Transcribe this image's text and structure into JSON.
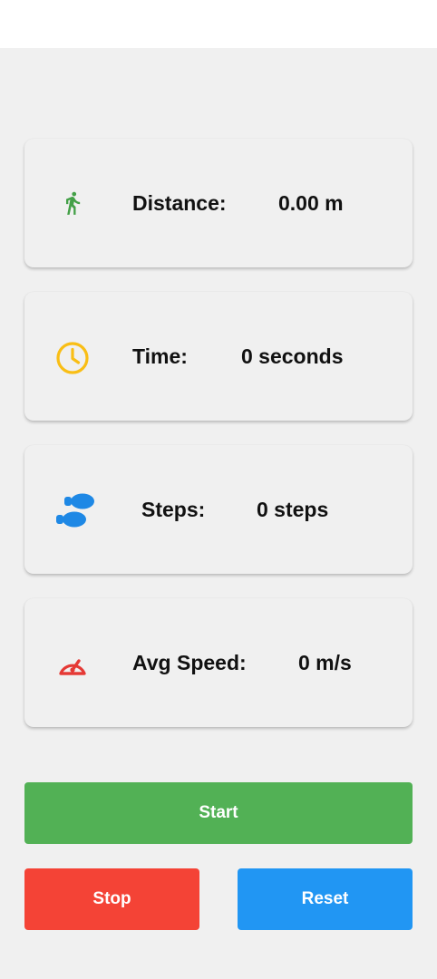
{
  "stats": [
    {
      "icon": "walk-icon",
      "label": "Distance:",
      "value": "0.00 m",
      "color": "#43a047"
    },
    {
      "icon": "clock-icon",
      "label": "Time:",
      "value": "0 seconds",
      "color": "#f9be15"
    },
    {
      "icon": "footsteps-icon",
      "label": "Steps:",
      "value": "0 steps",
      "color": "#1e88e5"
    },
    {
      "icon": "speedometer-icon",
      "label": "Avg Speed:",
      "value": "0 m/s",
      "color": "#e53935"
    }
  ],
  "buttons": {
    "start": {
      "label": "Start",
      "color": "#52b155"
    },
    "stop": {
      "label": "Stop",
      "color": "#f44336"
    },
    "reset": {
      "label": "Reset",
      "color": "#2196f3"
    }
  }
}
